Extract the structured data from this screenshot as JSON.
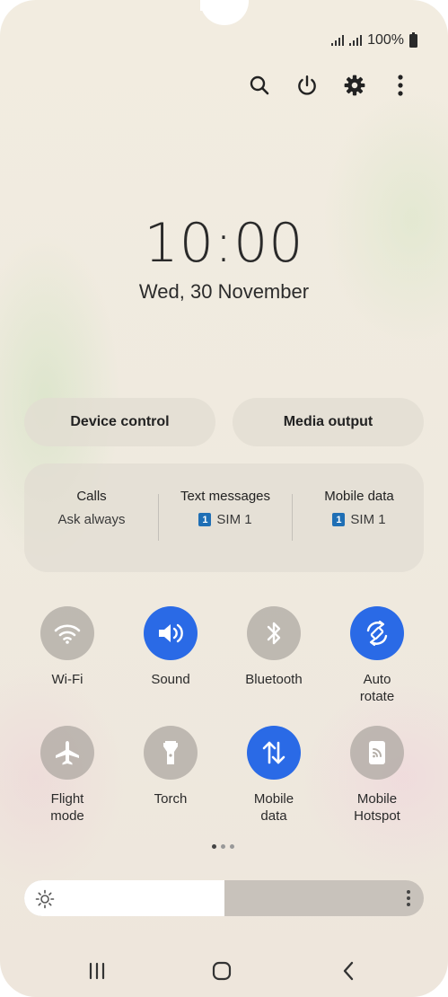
{
  "status_bar": {
    "battery_text": "100%"
  },
  "top_actions": [
    {
      "name": "search-icon"
    },
    {
      "name": "power-icon"
    },
    {
      "name": "gear-icon"
    },
    {
      "name": "more-vert-icon"
    }
  ],
  "lockscreen": {
    "time": "10:00",
    "date": "Wed, 30 November"
  },
  "pills": {
    "device_control": "Device control",
    "media_output": "Media output"
  },
  "sim_manager": {
    "calls": {
      "title": "Calls",
      "value": "Ask always"
    },
    "text_messages": {
      "title": "Text messages",
      "sim_number": "1",
      "value": "SIM 1"
    },
    "mobile_data": {
      "title": "Mobile data",
      "sim_number": "1",
      "value": "SIM 1"
    }
  },
  "tiles": [
    {
      "label": "Wi-Fi",
      "icon": "wifi-icon",
      "on": false
    },
    {
      "label": "Sound",
      "icon": "speaker-icon",
      "on": true
    },
    {
      "label": "Bluetooth",
      "icon": "bluetooth-icon",
      "on": false
    },
    {
      "label": "Auto\nrotate",
      "icon": "auto-rotate-icon",
      "on": true
    },
    {
      "label": "Flight\nmode",
      "icon": "airplane-icon",
      "on": false
    },
    {
      "label": "Torch",
      "icon": "torch-icon",
      "on": false
    },
    {
      "label": "Mobile\ndata",
      "icon": "mobile-data-icon",
      "on": true
    },
    {
      "label": "Mobile\nHotspot",
      "icon": "hotspot-icon",
      "on": false
    }
  ],
  "page_indicator": {
    "current": 1,
    "total": 3
  },
  "brightness": {
    "level": 0.5
  },
  "colors": {
    "accent": "#2a6ae6",
    "tile_off": "#b4aea7",
    "sim_badge": "#1f6fb5"
  },
  "nav_bar": [
    {
      "name": "recent-apps-icon"
    },
    {
      "name": "home-icon"
    },
    {
      "name": "back-icon"
    }
  ]
}
